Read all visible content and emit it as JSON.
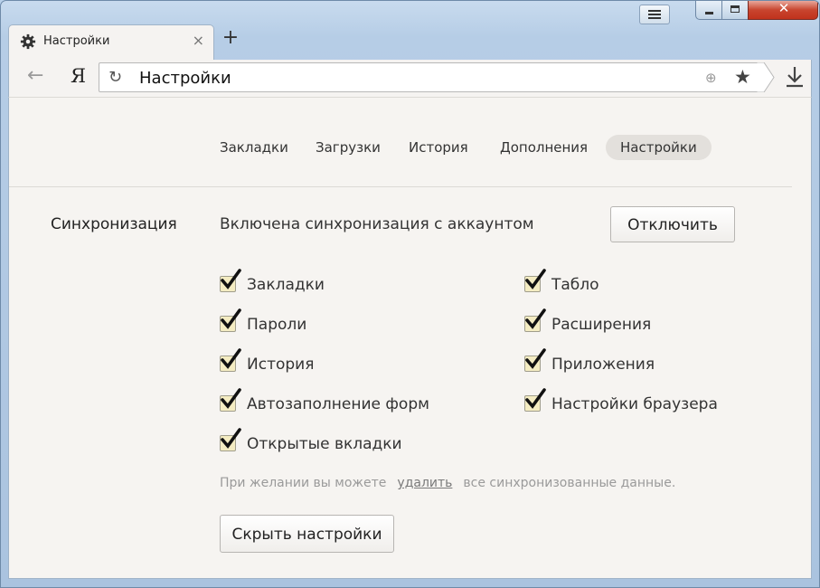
{
  "window": {
    "tab_title": "Настройки",
    "tab_close": "×",
    "new_tab": "+",
    "close_symbol": "✕"
  },
  "toolbar": {
    "back": "←",
    "logo": "Я",
    "reload": "↻",
    "url": "Настройки",
    "globe": "⊕",
    "star": "★"
  },
  "nav": {
    "items": [
      "Закладки",
      "Загрузки",
      "История",
      "Дополнения",
      "Настройки"
    ],
    "active": "Настройки"
  },
  "sync": {
    "section_title": "Синхронизация",
    "status": "Включена синхронизация с аккаунтом",
    "disable_button": "Отключить",
    "left_items": [
      "Закладки",
      "Пароли",
      "История",
      "Автозаполнение форм",
      "Открытые вкладки"
    ],
    "right_items": [
      "Табло",
      "Расширения",
      "Приложения",
      "Настройки браузера"
    ],
    "hint_before": "При желании вы можете",
    "hint_link": "удалить",
    "hint_after": "все синхронизованные данные.",
    "hide_button": "Скрыть настройки"
  },
  "colors": {
    "checkbox_fill": "#f4ecc2",
    "close_button": "#c8452f"
  }
}
